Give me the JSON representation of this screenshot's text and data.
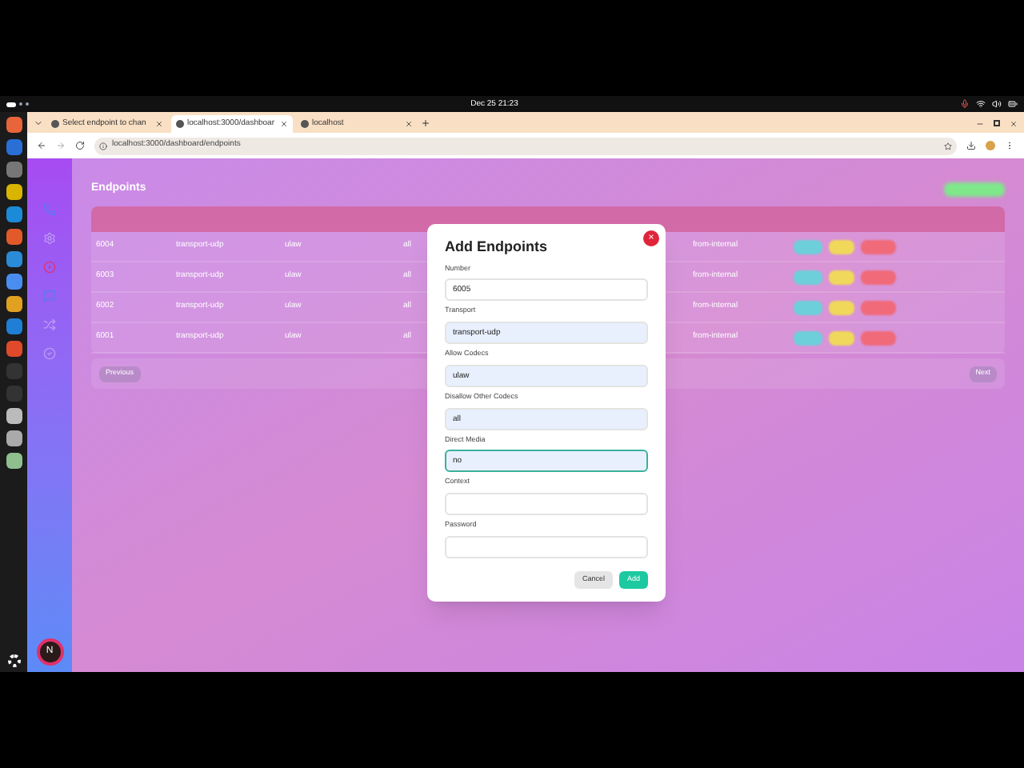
{
  "top_bar": {
    "clock": "Dec 25  21:23"
  },
  "browser": {
    "tabs": [
      {
        "title": "Select endpoint to chan",
        "selected": false
      },
      {
        "title": "localhost:3000/dashboar",
        "selected": true
      },
      {
        "title": "localhost",
        "selected": false
      }
    ],
    "address": "localhost:3000/dashboard/endpoints"
  },
  "sidebar": {
    "avatar": "N"
  },
  "page": {
    "title": "Endpoints",
    "rows": [
      [
        "6004",
        "transport-udp",
        "ulaw",
        "all",
        "from-internal"
      ],
      [
        "6003",
        "transport-udp",
        "ulaw",
        "all",
        "from-internal"
      ],
      [
        "6002",
        "transport-udp",
        "ulaw",
        "all",
        "from-internal"
      ],
      [
        "6001",
        "transport-udp",
        "ulaw",
        "all",
        "from-internal"
      ]
    ],
    "pagination": [
      "Previous",
      "Next"
    ]
  },
  "dialog": {
    "title": "Add Endpoints",
    "close": "×",
    "fields": [
      {
        "label": "Number",
        "value": "6005",
        "autofilled": false,
        "focused": false
      },
      {
        "label": "Transport",
        "value": "transport-udp",
        "autofilled": true,
        "focused": false
      },
      {
        "label": "Allow Codecs",
        "value": "ulaw",
        "autofilled": true,
        "focused": false
      },
      {
        "label": "Disallow Other Codecs",
        "value": "all",
        "autofilled": true,
        "focused": false
      },
      {
        "label": "Direct Media",
        "value": "no",
        "autofilled": true,
        "focused": true
      },
      {
        "label": "Context",
        "autofilled": false,
        "focused": false
      },
      {
        "label": "Password",
        "autofilled": false,
        "focused": false
      }
    ],
    "buttons": [
      "Cancel",
      "Add"
    ]
  }
}
